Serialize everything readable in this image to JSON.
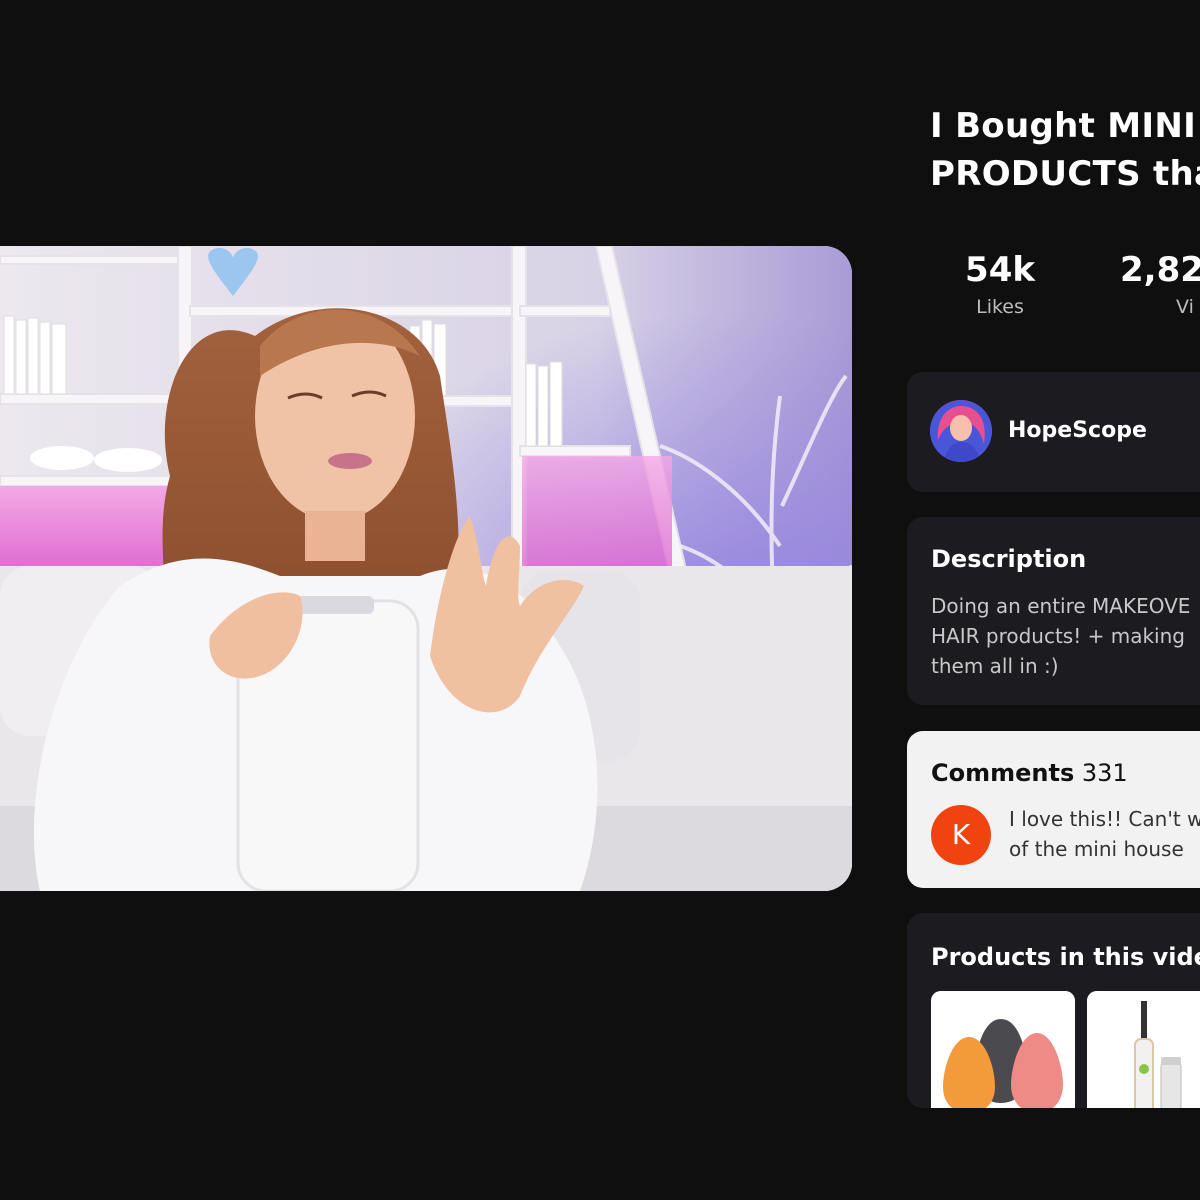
{
  "video": {
    "title": "I Bought MINI B\nPRODUCTS that",
    "likes_value": "54k",
    "likes_label": "Likes",
    "views_value": "2,82",
    "views_label": "Vi"
  },
  "channel": {
    "name": "HopeScope"
  },
  "description": {
    "heading": "Description",
    "body": "Doing an entire MAKEOVE\nHAIR products! + making\nthem all in :)"
  },
  "comments": {
    "heading": "Comments",
    "count": "331",
    "first": {
      "avatar_letter": "K",
      "avatar_color": "#f0430f",
      "text": "I love this!! Can't w\nof the mini house"
    }
  },
  "products": {
    "heading": "Products in this vide",
    "items": [
      {
        "icon": "makeup-sponges-image"
      },
      {
        "icon": "eyelash-curler-image"
      }
    ]
  },
  "colors": {
    "background": "#0f0f0f",
    "card": "#1c1b1f",
    "comment_card": "#f2f2f2"
  }
}
